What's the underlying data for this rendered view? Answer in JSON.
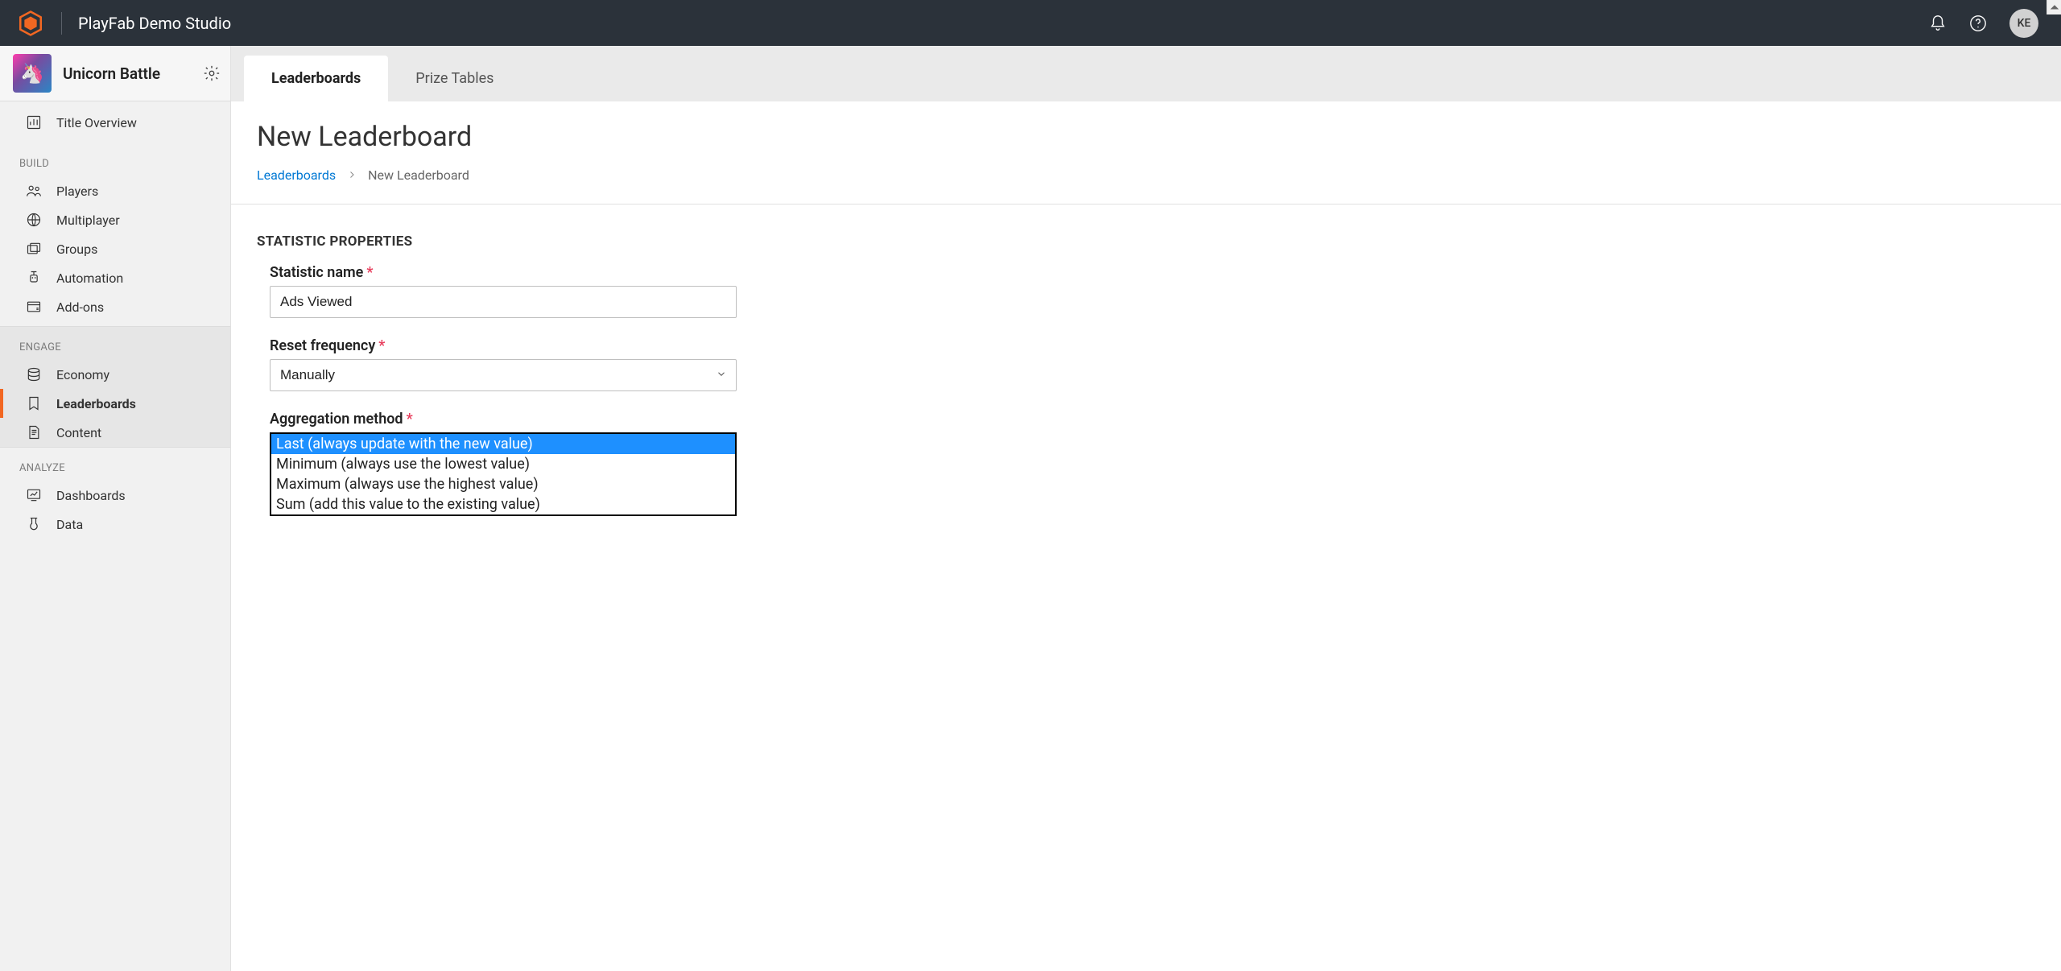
{
  "header": {
    "studio_name": "PlayFab Demo Studio",
    "avatar_initials": "KE"
  },
  "sidebar": {
    "title_name": "Unicorn Battle",
    "overview_label": "Title Overview",
    "sections": {
      "build": {
        "label": "BUILD",
        "items": [
          {
            "label": "Players"
          },
          {
            "label": "Multiplayer"
          },
          {
            "label": "Groups"
          },
          {
            "label": "Automation"
          },
          {
            "label": "Add-ons"
          }
        ]
      },
      "engage": {
        "label": "ENGAGE",
        "items": [
          {
            "label": "Economy"
          },
          {
            "label": "Leaderboards"
          },
          {
            "label": "Content"
          }
        ]
      },
      "analyze": {
        "label": "ANALYZE",
        "items": [
          {
            "label": "Dashboards"
          },
          {
            "label": "Data"
          }
        ]
      }
    },
    "active_item": "Leaderboards"
  },
  "tabs": [
    {
      "label": "Leaderboards",
      "active": true
    },
    {
      "label": "Prize Tables",
      "active": false
    }
  ],
  "page": {
    "title": "New Leaderboard",
    "breadcrumb": {
      "root": "Leaderboards",
      "current": "New Leaderboard"
    }
  },
  "form": {
    "section_heading": "STATISTIC PROPERTIES",
    "statistic_name": {
      "label": "Statistic name",
      "value": "Ads Viewed"
    },
    "reset_frequency": {
      "label": "Reset frequency",
      "value": "Manually"
    },
    "aggregation_method": {
      "label": "Aggregation method",
      "options": [
        "Last (always update with the new value)",
        "Minimum (always use the lowest value)",
        "Maximum (always use the highest value)",
        "Sum (add this value to the existing value)"
      ],
      "selected_index": 0
    }
  }
}
